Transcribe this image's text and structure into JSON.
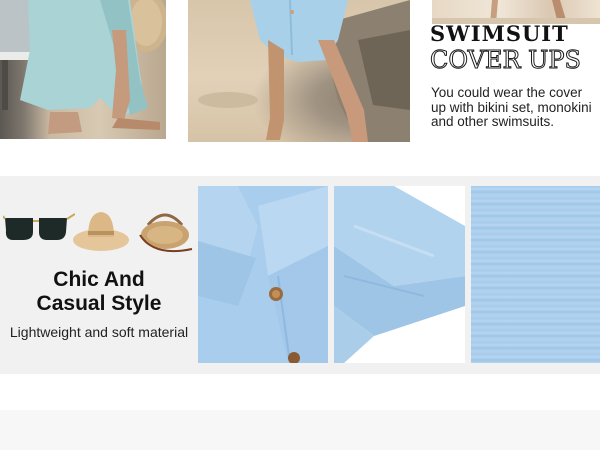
{
  "hero": {
    "headline_line1": "SWIMSUIT",
    "headline_line2": "COVER UPS",
    "description": "You could wear the cover up with bikini set, monokini and other swimsuits."
  },
  "features": {
    "title_line1": "Chic And",
    "title_line2": "Casual Style",
    "subtitle": "Lightweight and soft material"
  },
  "colors": {
    "fabric_blue": "#a9cdec",
    "band_gray": "#f1f1f1",
    "text_dark": "#111111"
  },
  "icons": [
    "sunglasses-icon",
    "sun-hat-icon",
    "straw-bag-icon"
  ]
}
